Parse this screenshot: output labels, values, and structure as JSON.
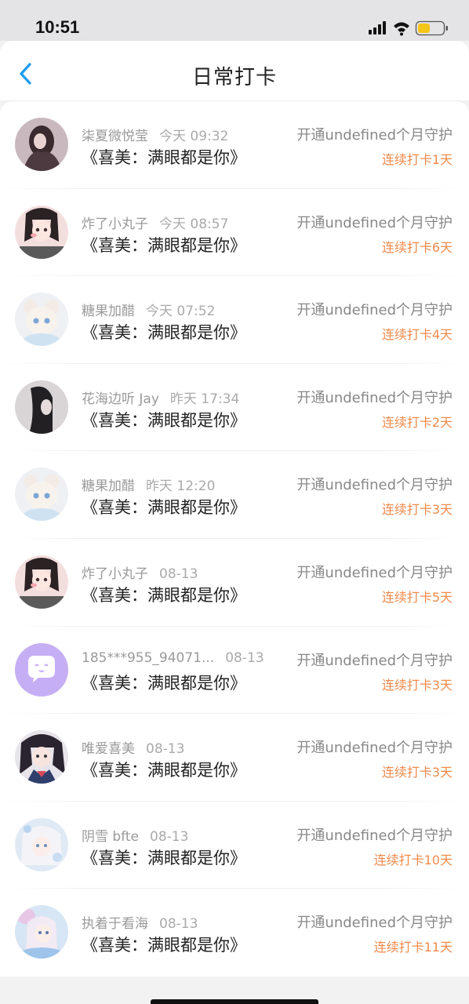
{
  "status_bar": {
    "time": "10:51"
  },
  "nav": {
    "title": "日常打卡",
    "back_icon": "chevron-left-icon"
  },
  "items": [
    {
      "name": "柒夏微悦莹",
      "time": "今天 09:32",
      "song": "《喜美：满眼都是你》",
      "guard": "开通undefined个月守护",
      "streak": "连续打卡1天",
      "avatar": "avatar-dark-girl"
    },
    {
      "name": "炸了小丸子",
      "time": "今天 08:57",
      "song": "《喜美：满眼都是你》",
      "guard": "开通undefined个月守护",
      "streak": "连续打卡6天",
      "avatar": "avatar-anime-girl-pink"
    },
    {
      "name": "糖果加醋",
      "time": "今天 07:52",
      "song": "《喜美：满眼都是你》",
      "guard": "开通undefined个月守护",
      "streak": "连续打卡4天",
      "avatar": "avatar-pastel-bear"
    },
    {
      "name": "花海边听 Jay",
      "time": "昨天 17:34",
      "song": "《喜美：满眼都是你》",
      "guard": "开通undefined个月守护",
      "streak": "连续打卡2天",
      "avatar": "avatar-dark-profile"
    },
    {
      "name": "糖果加醋",
      "time": "昨天 12:20",
      "song": "《喜美：满眼都是你》",
      "guard": "开通undefined个月守护",
      "streak": "连续打卡3天",
      "avatar": "avatar-pastel-bear"
    },
    {
      "name": "炸了小丸子",
      "time": "08-13",
      "song": "《喜美：满眼都是你》",
      "guard": "开通undefined个月守护",
      "streak": "连续打卡5天",
      "avatar": "avatar-anime-girl-pink"
    },
    {
      "name": "185***955_94071...",
      "time": "08-13",
      "song": "《喜美：满眼都是你》",
      "guard": "开通undefined个月守护",
      "streak": "连续打卡3天",
      "avatar": "avatar-purple-chat"
    },
    {
      "name": "唯爱喜美",
      "time": "08-13",
      "song": "《喜美：满眼都是你》",
      "guard": "开通undefined个月守护",
      "streak": "连续打卡3天",
      "avatar": "avatar-anime-school-girl"
    },
    {
      "name": "阴雪 bfte",
      "time": "08-13",
      "song": "《喜美：满眼都是你》",
      "guard": "开通undefined个月守护",
      "streak": "连续打卡10天",
      "avatar": "avatar-light-blue-girl"
    },
    {
      "name": "执着于看海",
      "time": "08-13",
      "song": "《喜美：满眼都是你》",
      "guard": "开通undefined个月守护",
      "streak": "连续打卡11天",
      "avatar": "avatar-pastel-sea-girl"
    }
  ],
  "colors": {
    "accent_blue": "#1a9bf0",
    "streak_orange": "#f08a4b",
    "chat_purple": "#c6aef5"
  }
}
